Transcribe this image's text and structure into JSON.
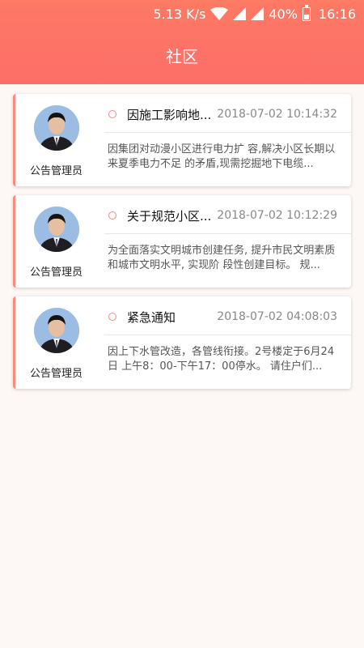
{
  "status_bar": {
    "speed": "5.13 K/s",
    "battery": "40%",
    "time": "16:16"
  },
  "header": {
    "title": "社区"
  },
  "notices": [
    {
      "author": "公告管理员",
      "title": "因施工影响地...",
      "time": "2018-07-02 10:14:32",
      "body": "因集团对动漫小区进行电力扩 容,解决小区长期以来夏季电力不足 的矛盾,现需挖掘地下电缆..."
    },
    {
      "author": "公告管理员",
      "title": "关于规范小区...",
      "time": "2018-07-02 10:12:29",
      "body": "为全面落实文明城市创建任务, 提升市民文明素质和城市文明水平, 实现阶 段性创建目标。 规..."
    },
    {
      "author": "公告管理员",
      "title": "紧急通知",
      "time": "2018-07-02 04:08:03",
      "body": "因上下水管改造，各管线衔接。2号楼定于6月24日 上午8：00-下午17：00停水。 请住户们..."
    }
  ],
  "colors": {
    "header_start": "#fd7a63",
    "header_end": "#fd6e69",
    "accent": "#fa8a7a"
  },
  "icons": [
    "wifi-icon",
    "signal-icon",
    "battery-icon"
  ]
}
